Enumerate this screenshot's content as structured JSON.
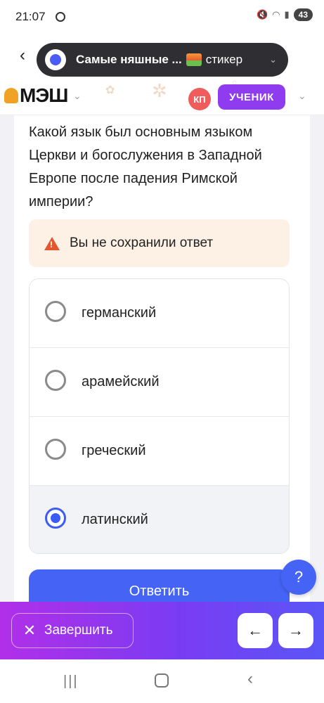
{
  "status_bar": {
    "time": "21:07",
    "battery": "43",
    "icons": [
      "mute-icon",
      "wifi-icon",
      "signal-icon",
      "battery-icon"
    ]
  },
  "media_pill": {
    "title": "Самые няшные ...",
    "subtitle": "стикер"
  },
  "header": {
    "logo": "МЭШ",
    "avatar_initials": "КП",
    "role": "УЧЕНИК"
  },
  "question": {
    "text": "Какой язык был основным языком Церкви и богослужения в Западной Европе после падения Римской империи?"
  },
  "warning": {
    "text": "Вы не сохранили ответ"
  },
  "options": [
    {
      "label": "германский",
      "selected": false
    },
    {
      "label": "арамейский",
      "selected": false
    },
    {
      "label": "греческий",
      "selected": false
    },
    {
      "label": "латинский",
      "selected": true
    }
  ],
  "actions": {
    "submit": "Ответить",
    "help": "?",
    "finish": "Завершить",
    "prev": "←",
    "next": "→",
    "close": "✕"
  },
  "colors": {
    "accent": "#4564f5",
    "role_badge": "#8f3cf0",
    "warning_bg": "#fdf1e6",
    "warning_icon": "#e4572e",
    "bottom_bar_start": "#b12fe8",
    "bottom_bar_end": "#5a55f6"
  }
}
